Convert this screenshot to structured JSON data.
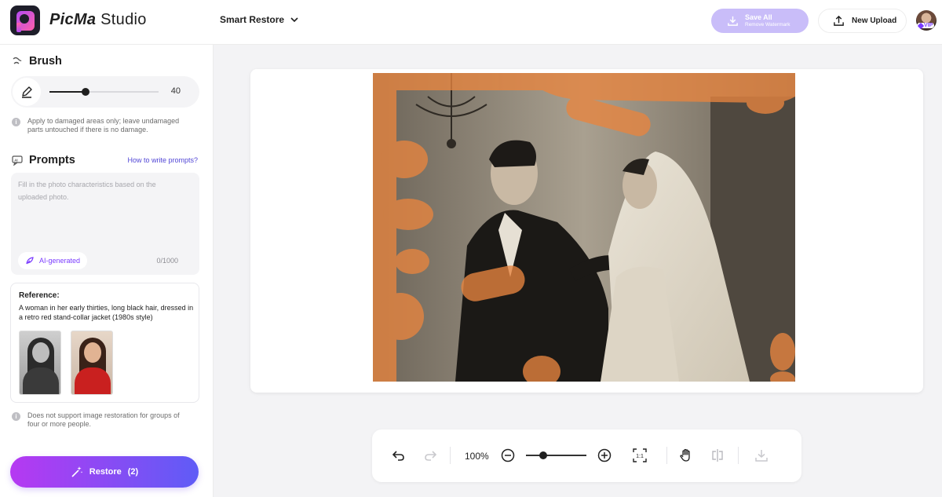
{
  "header": {
    "brand_bold": "PicMa",
    "brand_light": " Studio",
    "mode_label": "Smart Restore",
    "save_label": "Save All",
    "save_sub": "Remove Watermark",
    "upload_label": "New Upload",
    "vip_label": "VIP"
  },
  "sidebar": {
    "brush_title": "Brush",
    "brush_value": "40",
    "brush_level": 0.33,
    "brush_note": "Apply to damaged areas only; leave undamaged parts untouched if there is no damage.",
    "prompts_title": "Prompts",
    "howto_link": "How to write prompts?",
    "prompt_placeholder": "Fill in the photo characteristics based on the uploaded photo.",
    "ai_chip": "AI-generated",
    "counter": "0/1000",
    "reference_title": "Reference:",
    "reference_text": "A woman in her early thirties, long black hair, dressed in a retro red stand-collar jacket (1980s style)",
    "group_note": "Does not support image restoration for groups of four or more people.",
    "restore_label": "Restore",
    "restore_count": "(2)"
  },
  "toolbar": {
    "zoom": "100%",
    "zoom_level": 0.28,
    "actual_size": "1:1"
  },
  "colors": {
    "accent": "#7a3bff",
    "brush_mark": "#e8853f"
  },
  "icons": [
    "logo-icon",
    "chevron-down-icon",
    "download-icon",
    "upload-icon",
    "brush-icon",
    "pen-icon",
    "info-icon",
    "prompt-icon",
    "feather-icon",
    "magic-wand-icon",
    "undo-icon",
    "redo-icon",
    "zoom-out-icon",
    "zoom-in-icon",
    "fit-icon",
    "hand-icon",
    "compare-icon"
  ]
}
